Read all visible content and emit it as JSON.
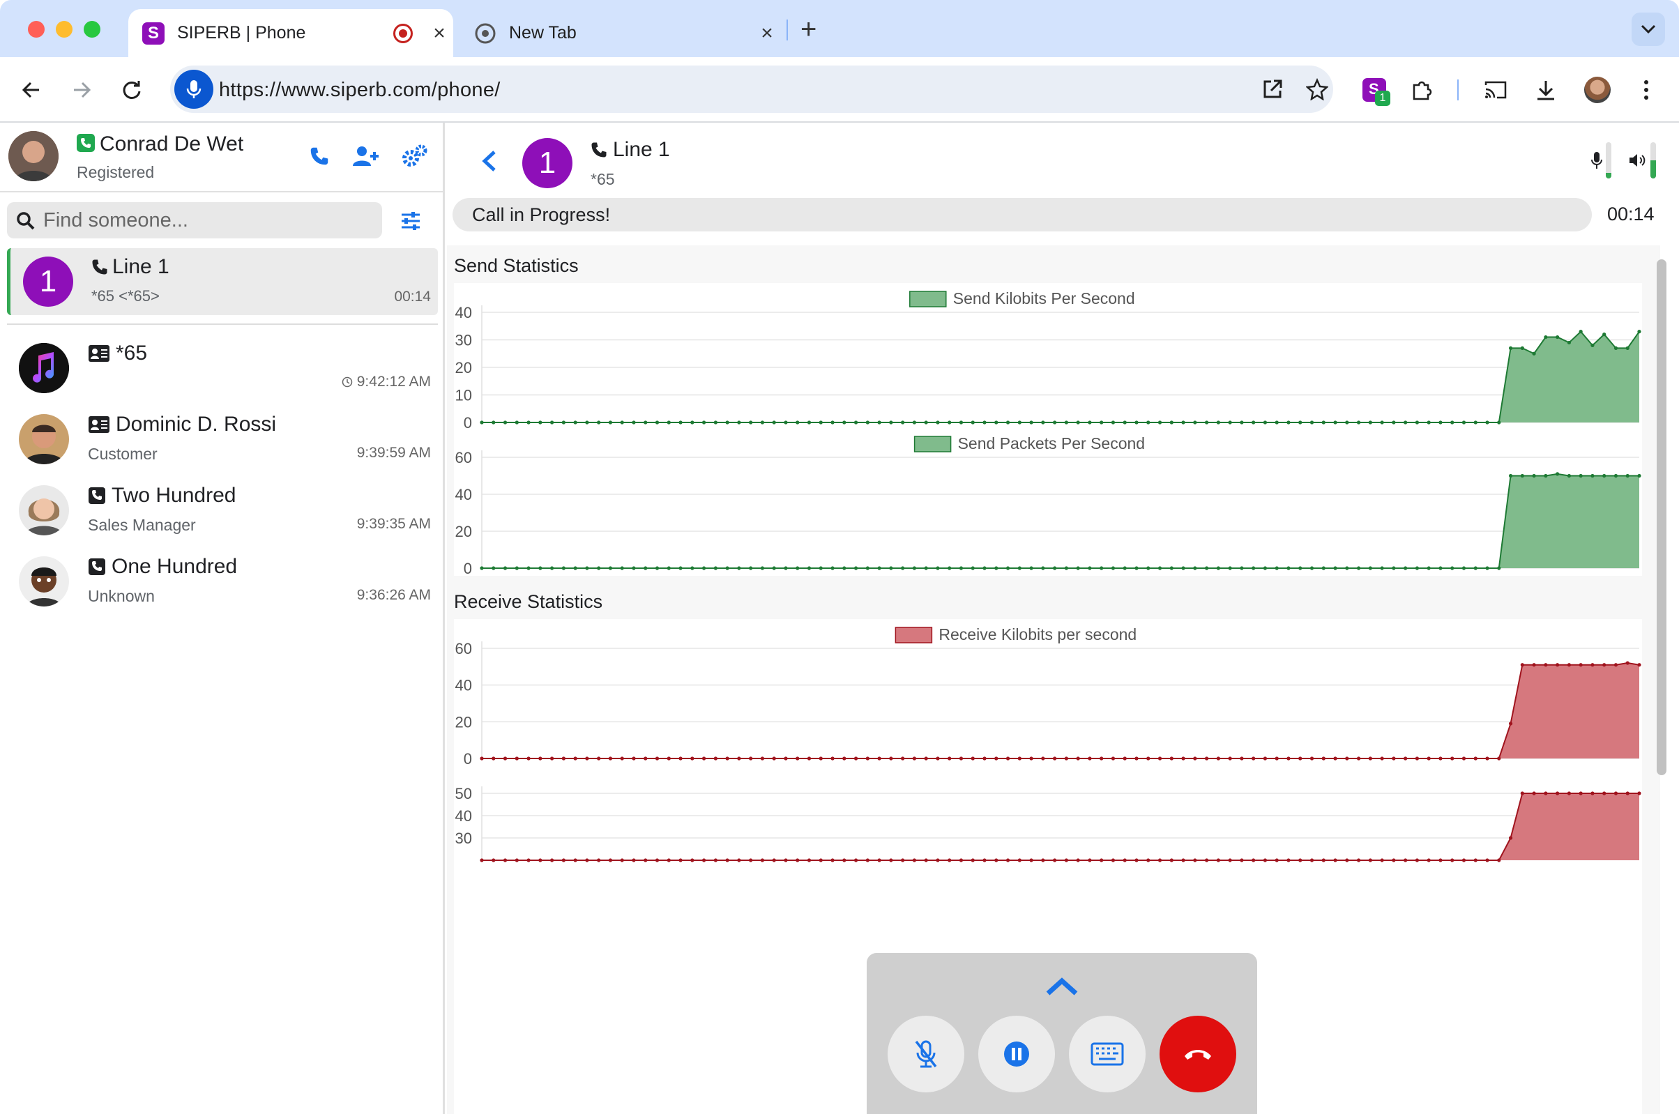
{
  "browser": {
    "tabs": [
      {
        "title": "SIPERB | Phone",
        "favicon": "siperb-icon",
        "recording": true
      },
      {
        "title": "New Tab",
        "favicon": "chrome-icon"
      }
    ],
    "url": "https://www.siperb.com/phone/",
    "extension_badge": "1"
  },
  "profile": {
    "name": "Conrad De Wet",
    "status": "Registered"
  },
  "search": {
    "placeholder": "Find someone..."
  },
  "active_line": {
    "title": "Line 1",
    "number": "1",
    "detail": "*65 <*65>",
    "duration": "00:14"
  },
  "contacts": [
    {
      "name": "*65",
      "type": "contact-card-icon",
      "sub": "",
      "time": "9:42:12 AM",
      "clock": true
    },
    {
      "name": "Dominic D. Rossi",
      "type": "contact-card-icon",
      "sub": "Customer",
      "time": "9:39:59 AM"
    },
    {
      "name": "Two Hundred",
      "type": "phone-square-icon",
      "sub": "Sales Manager",
      "time": "9:39:35 AM"
    },
    {
      "name": "One Hundred",
      "type": "phone-square-icon",
      "sub": "Unknown",
      "time": "9:36:26 AM"
    }
  ],
  "call": {
    "line_title": "Line 1",
    "line_number": "1",
    "line_sub": "*65",
    "status": "Call in Progress!",
    "elapsed": "00:14",
    "mic_level": 0.15,
    "speaker_level": 0.5
  },
  "stats": {
    "send_title": "Send Statistics",
    "receive_title": "Receive Statistics"
  },
  "colors": {
    "green_fill": "#80bb8c",
    "green_line": "#1e7a34",
    "red_fill": "#d6787e",
    "red_line": "#a0141e",
    "accent_blue": "#1a73e8",
    "purple": "#8e0fb8",
    "hangup": "#e00f0f"
  },
  "chart_data": [
    {
      "type": "area",
      "legend": "Send Kilobits Per Second",
      "ylim": [
        0,
        40
      ],
      "yticks": [
        0,
        10,
        20,
        30,
        40
      ],
      "points": 100,
      "values": [
        0,
        0,
        0,
        0,
        0,
        0,
        0,
        0,
        0,
        0,
        0,
        0,
        0,
        0,
        0,
        0,
        0,
        0,
        0,
        0,
        0,
        0,
        0,
        0,
        0,
        0,
        0,
        0,
        0,
        0,
        0,
        0,
        0,
        0,
        0,
        0,
        0,
        0,
        0,
        0,
        0,
        0,
        0,
        0,
        0,
        0,
        0,
        0,
        0,
        0,
        0,
        0,
        0,
        0,
        0,
        0,
        0,
        0,
        0,
        0,
        0,
        0,
        0,
        0,
        0,
        0,
        0,
        0,
        0,
        0,
        0,
        0,
        0,
        0,
        0,
        0,
        0,
        0,
        0,
        0,
        0,
        0,
        0,
        0,
        0,
        0,
        0,
        0,
        27,
        27,
        25,
        31,
        31,
        29,
        33,
        28,
        32,
        27,
        27,
        33
      ]
    },
    {
      "type": "area",
      "legend": "Send Packets Per Second",
      "ylim": [
        0,
        60
      ],
      "yticks": [
        0,
        20,
        40,
        60
      ],
      "points": 100,
      "values": [
        0,
        0,
        0,
        0,
        0,
        0,
        0,
        0,
        0,
        0,
        0,
        0,
        0,
        0,
        0,
        0,
        0,
        0,
        0,
        0,
        0,
        0,
        0,
        0,
        0,
        0,
        0,
        0,
        0,
        0,
        0,
        0,
        0,
        0,
        0,
        0,
        0,
        0,
        0,
        0,
        0,
        0,
        0,
        0,
        0,
        0,
        0,
        0,
        0,
        0,
        0,
        0,
        0,
        0,
        0,
        0,
        0,
        0,
        0,
        0,
        0,
        0,
        0,
        0,
        0,
        0,
        0,
        0,
        0,
        0,
        0,
        0,
        0,
        0,
        0,
        0,
        0,
        0,
        0,
        0,
        0,
        0,
        0,
        0,
        0,
        0,
        0,
        0,
        50,
        50,
        50,
        50,
        51,
        50,
        50,
        50,
        50,
        50,
        50,
        50
      ]
    },
    {
      "type": "area",
      "legend": "Receive Kilobits per second",
      "ylim": [
        0,
        60
      ],
      "yticks": [
        0,
        20,
        40,
        60
      ],
      "points": 100,
      "values": [
        0,
        0,
        0,
        0,
        0,
        0,
        0,
        0,
        0,
        0,
        0,
        0,
        0,
        0,
        0,
        0,
        0,
        0,
        0,
        0,
        0,
        0,
        0,
        0,
        0,
        0,
        0,
        0,
        0,
        0,
        0,
        0,
        0,
        0,
        0,
        0,
        0,
        0,
        0,
        0,
        0,
        0,
        0,
        0,
        0,
        0,
        0,
        0,
        0,
        0,
        0,
        0,
        0,
        0,
        0,
        0,
        0,
        0,
        0,
        0,
        0,
        0,
        0,
        0,
        0,
        0,
        0,
        0,
        0,
        0,
        0,
        0,
        0,
        0,
        0,
        0,
        0,
        0,
        0,
        0,
        0,
        0,
        0,
        0,
        0,
        0,
        0,
        0,
        19,
        51,
        51,
        51,
        51,
        51,
        51,
        51,
        51,
        51,
        52,
        51
      ]
    },
    {
      "type": "area",
      "legend": "",
      "ylim": [
        20,
        50
      ],
      "yticks": [
        30,
        40,
        50
      ],
      "points": 100,
      "values": [
        0,
        0,
        0,
        0,
        0,
        0,
        0,
        0,
        0,
        0,
        0,
        0,
        0,
        0,
        0,
        0,
        0,
        0,
        0,
        0,
        0,
        0,
        0,
        0,
        0,
        0,
        0,
        0,
        0,
        0,
        0,
        0,
        0,
        0,
        0,
        0,
        0,
        0,
        0,
        0,
        0,
        0,
        0,
        0,
        0,
        0,
        0,
        0,
        0,
        0,
        0,
        0,
        0,
        0,
        0,
        0,
        0,
        0,
        0,
        0,
        0,
        0,
        0,
        0,
        0,
        0,
        0,
        0,
        0,
        0,
        0,
        0,
        0,
        0,
        0,
        0,
        0,
        0,
        0,
        0,
        0,
        0,
        0,
        0,
        0,
        0,
        0,
        0,
        30,
        50,
        50,
        50,
        50,
        50,
        50,
        50,
        50,
        50,
        50,
        50
      ]
    }
  ]
}
